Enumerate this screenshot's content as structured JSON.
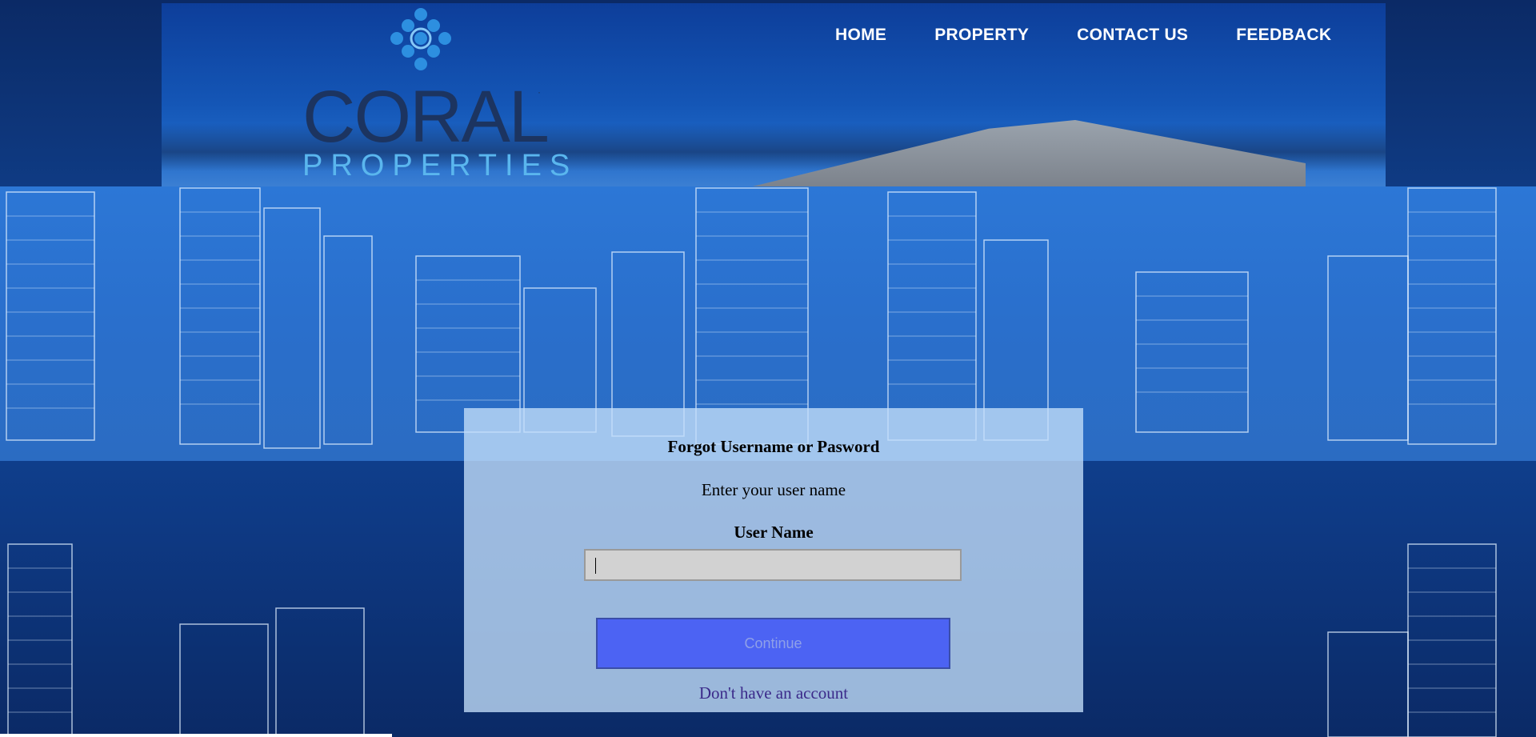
{
  "brand": {
    "name": "CORAL",
    "sub": "PROPERTIES",
    "mark": "·",
    "colors": {
      "dark": "#1c3460",
      "accent": "#5ab6ee"
    }
  },
  "nav": {
    "items": [
      "HOME",
      "PROPERTY",
      "CONTACT US",
      "FEEDBACK"
    ]
  },
  "form": {
    "title": "Forgot Username or Pasword",
    "subtitle": "Enter your user name",
    "field_label": "User Name",
    "field_value": "",
    "field_placeholder": "",
    "button_label": "Continue",
    "link_label": "Don't have an account",
    "button_color": "#4c63f3"
  }
}
